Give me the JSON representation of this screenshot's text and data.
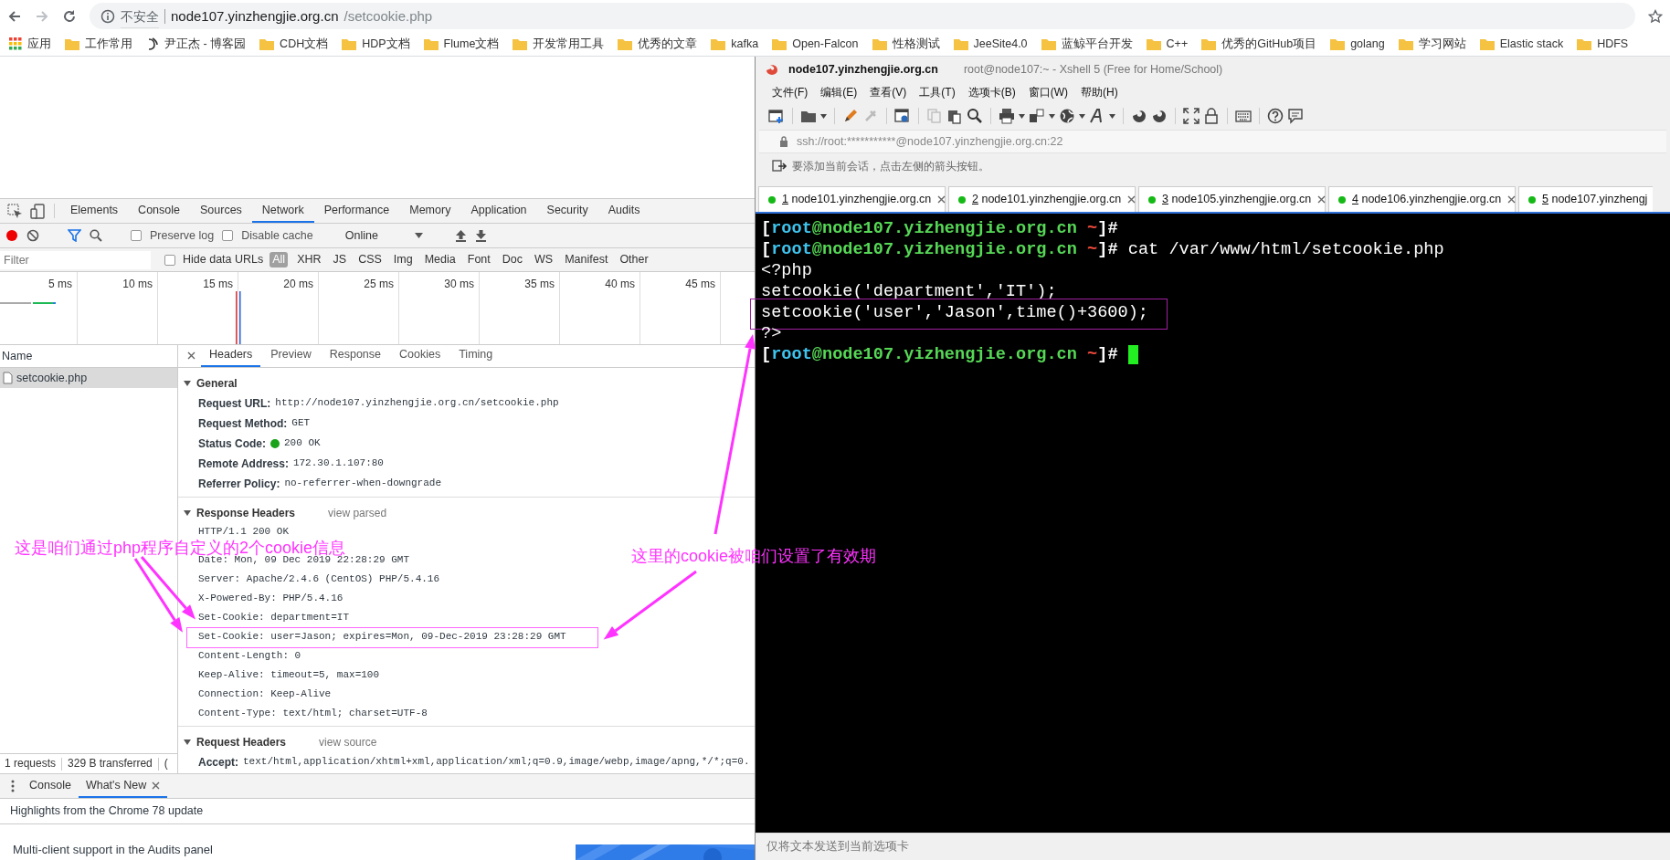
{
  "browser": {
    "address_bar": {
      "security_label": "不安全",
      "host": "node107.yinzhengjie.org.cn",
      "path": "/setcookie.php"
    },
    "bookmarks": [
      {
        "kind": "apps",
        "label": "应用"
      },
      {
        "kind": "folder",
        "label": "工作常用"
      },
      {
        "kind": "site",
        "label": "尹正杰 - 博客园"
      },
      {
        "kind": "folder",
        "label": "CDH文档"
      },
      {
        "kind": "folder",
        "label": "HDP文档"
      },
      {
        "kind": "folder",
        "label": "Flume文档"
      },
      {
        "kind": "folder",
        "label": "开发常用工具"
      },
      {
        "kind": "folder",
        "label": "优秀的文章"
      },
      {
        "kind": "folder",
        "label": "kafka"
      },
      {
        "kind": "folder",
        "label": "Open-Falcon"
      },
      {
        "kind": "folder",
        "label": "性格测试"
      },
      {
        "kind": "folder",
        "label": "JeeSite4.0"
      },
      {
        "kind": "folder",
        "label": "蓝鲸平台开发"
      },
      {
        "kind": "folder",
        "label": "C++"
      },
      {
        "kind": "folder",
        "label": "优秀的GitHub项目"
      },
      {
        "kind": "folder",
        "label": "golang"
      },
      {
        "kind": "folder",
        "label": "学习网站"
      },
      {
        "kind": "folder",
        "label": "Elastic stack"
      },
      {
        "kind": "folder",
        "label": "HDFS"
      }
    ]
  },
  "devtools": {
    "tabs": [
      {
        "label": "Elements",
        "selected": false
      },
      {
        "label": "Console",
        "selected": false
      },
      {
        "label": "Sources",
        "selected": false
      },
      {
        "label": "Network",
        "selected": true
      },
      {
        "label": "Performance",
        "selected": false
      },
      {
        "label": "Memory",
        "selected": false
      },
      {
        "label": "Application",
        "selected": false
      },
      {
        "label": "Security",
        "selected": false
      },
      {
        "label": "Audits",
        "selected": false
      }
    ],
    "toolbar": {
      "checkboxes": [
        {
          "label": "Preserve log",
          "checked": false
        },
        {
          "label": "Disable cache",
          "checked": false
        }
      ],
      "throttling": "Online"
    },
    "filter": {
      "placeholder": "Filter",
      "checkbox": {
        "label": "Hide data URLs",
        "checked": false
      },
      "types": [
        {
          "label": "All",
          "selected": true
        },
        {
          "label": "XHR",
          "selected": false
        },
        {
          "label": "JS",
          "selected": false
        },
        {
          "label": "CSS",
          "selected": false
        },
        {
          "label": "Img",
          "selected": false
        },
        {
          "label": "Media",
          "selected": false
        },
        {
          "label": "Font",
          "selected": false
        },
        {
          "label": "Doc",
          "selected": false
        },
        {
          "label": "WS",
          "selected": false
        },
        {
          "label": "Manifest",
          "selected": false
        },
        {
          "label": "Other",
          "selected": false
        }
      ]
    },
    "timeline_ticks": [
      "5 ms",
      "10 ms",
      "15 ms",
      "20 ms",
      "25 ms",
      "30 ms",
      "35 ms",
      "40 ms",
      "45 ms"
    ],
    "requests": {
      "column": "Name",
      "rows": [
        {
          "name": "setcookie.php",
          "selected": true
        }
      ],
      "summary": [
        "1 requests",
        "329 B transferred",
        "("
      ]
    },
    "details": {
      "tabs": [
        {
          "label": "Headers",
          "selected": true
        },
        {
          "label": "Preview",
          "selected": false
        },
        {
          "label": "Response",
          "selected": false
        },
        {
          "label": "Cookies",
          "selected": false
        },
        {
          "label": "Timing",
          "selected": false
        }
      ],
      "general": {
        "title": "General",
        "expanded": true,
        "rows": [
          {
            "label": "Request URL:",
            "value": "http://node107.yinzhengjie.org.cn/setcookie.php"
          },
          {
            "label": "Request Method:",
            "value": "GET"
          },
          {
            "label": "Status Code:",
            "value": "200 OK",
            "color": "#1aa31a"
          },
          {
            "label": "Remote Address:",
            "value": "172.30.1.107:80"
          },
          {
            "label": "Referrer Policy:",
            "value": "no-referrer-when-downgrade"
          }
        ]
      },
      "response_headers": {
        "title": "Response Headers",
        "expanded": true,
        "link": "view parsed",
        "lines": [
          "HTTP/1.1 200 OK",
          "Date: Mon, 09 Dec 2019 22:28:29 GMT",
          "Server: Apache/2.4.6 (CentOS) PHP/5.4.16",
          "X-Powered-By: PHP/5.4.16",
          "Set-Cookie: department=IT",
          "Set-Cookie: user=Jason; expires=Mon, 09-Dec-2019 23:28:29 GMT",
          "Content-Length: 0",
          "Keep-Alive: timeout=5, max=100",
          "Connection: Keep-Alive",
          "Content-Type: text/html; charset=UTF-8"
        ]
      },
      "request_headers": {
        "title": "Request Headers",
        "expanded": true,
        "link": "view source",
        "rows": [
          {
            "label": "Accept:",
            "value": "text/html,application/xhtml+xml,application/xml;q=0.9,image/webp,image/apng,*/*;q=0."
          }
        ]
      }
    },
    "drawer": {
      "tabs": [
        {
          "label": "Console",
          "selected": false,
          "closable": false
        },
        {
          "label": "What's New",
          "selected": true,
          "closable": true
        }
      ],
      "heading": "Highlights from the Chrome 78 update",
      "article": {
        "title": "Multi-client support in the Audits panel",
        "kind": "picture"
      }
    }
  },
  "xshell": {
    "title": "node107.yinzhengjie.org.cn",
    "subtitle": "root@node107:~ - Xshell 5 (Free for Home/School)",
    "menus": [
      "文件(F)",
      "编辑(E)",
      "查看(V)",
      "工具(T)",
      "选项卡(B)",
      "窗口(W)",
      "帮助(H)"
    ],
    "address": "ssh://root:***********@node107.yinzhengjie.org.cn:22",
    "hint": "要添加当前会话，点击左侧的箭头按钮。",
    "tabs": [
      {
        "number": "1",
        "label": "node101.yinzhengjie.org.cn"
      },
      {
        "number": "2",
        "label": "node101.yinzhengjie.org.cn"
      },
      {
        "number": "3",
        "label": "node105.yinzhengjie.org.cn"
      },
      {
        "number": "4",
        "label": "node106.yinzhengjie.org.cn"
      },
      {
        "number": "5",
        "label": "node107.yinzhengj"
      }
    ],
    "terminal": {
      "lines": [
        {
          "kind": "prompt",
          "open": "[",
          "user": "root",
          "host": "@node107.yizhengjie.org.cn",
          "dir": " ~",
          "close": "]#"
        },
        {
          "kind": "prompt",
          "open": "[",
          "user": "root",
          "host": "@node107.yizhengjie.org.cn",
          "dir": " ~",
          "close": "]#",
          "command": "cat /var/www/html/setcookie.php"
        },
        {
          "kind": "output",
          "text": "<?php"
        },
        {
          "kind": "output",
          "text": "setcookie('department','IT');"
        },
        {
          "kind": "output",
          "text": "setcookie('user','Jason',time()+3600);"
        },
        {
          "kind": "output",
          "text": "?>"
        },
        {
          "kind": "prompt",
          "open": "[",
          "user": "root",
          "host": "@node107.yizhengjie.org.cn",
          "dir": " ~",
          "close": "]#",
          "cursor": true
        }
      ]
    },
    "status_bar": "仅将文本发送到当前选项卡"
  },
  "annotations": [
    {
      "text": "这是咱们通过php程序自定义的2个cookie信息"
    },
    {
      "text": "这里的cookie被咱们设置了有效期"
    }
  ]
}
